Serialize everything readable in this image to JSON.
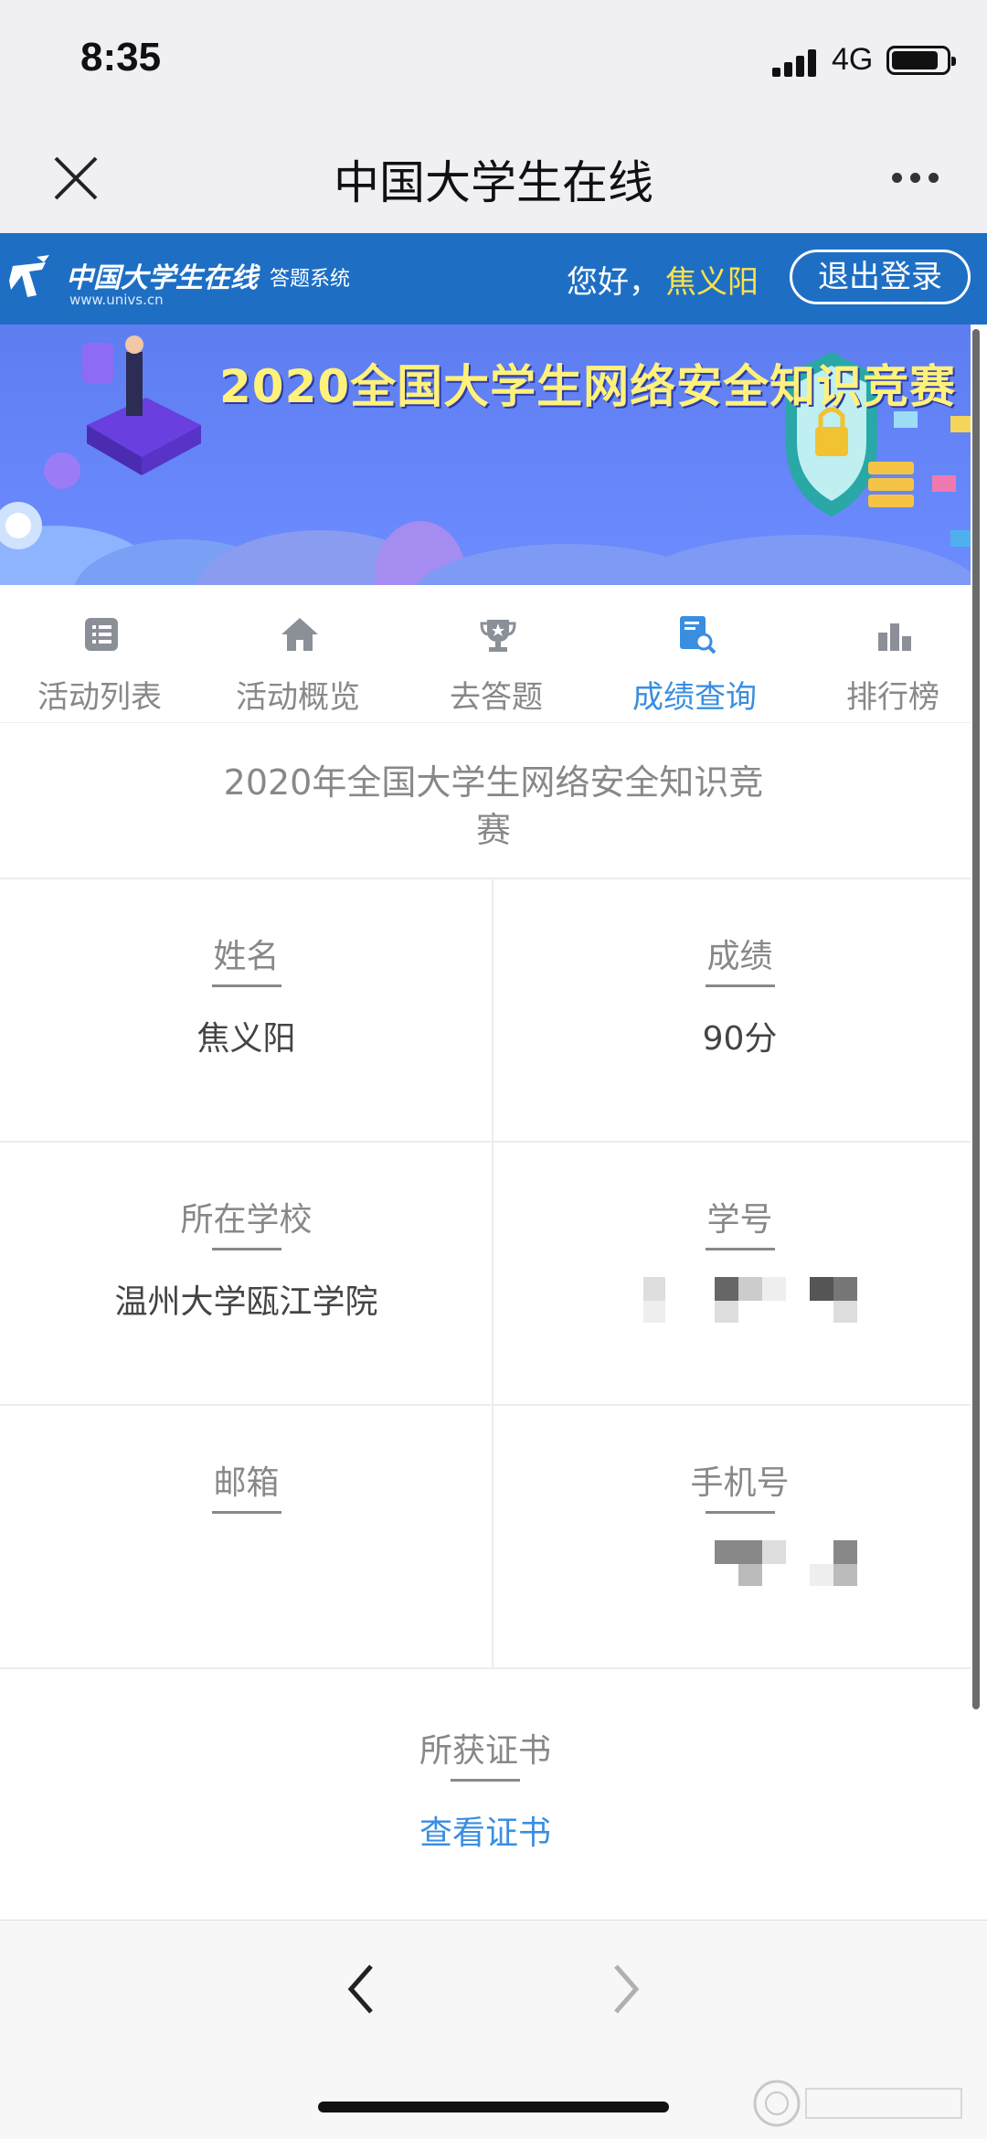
{
  "status_bar": {
    "time": "8:35",
    "network": "4G"
  },
  "nav": {
    "title": "中国大学生在线"
  },
  "web_header": {
    "logo_text": "中国大学生在线",
    "logo_sub": "答题系统",
    "logo_url": "www.univs.cn",
    "greeting": "您好，",
    "username": "焦义阳",
    "logout": "退出登录"
  },
  "banner": {
    "title": "2020全国大学生网络安全知识竞赛"
  },
  "tabs": [
    {
      "label": "活动列表",
      "icon": "list-icon"
    },
    {
      "label": "活动概览",
      "icon": "home-icon"
    },
    {
      "label": "去答题",
      "icon": "trophy-icon"
    },
    {
      "label": "成绩查询",
      "icon": "search-doc-icon",
      "active": true
    },
    {
      "label": "排行榜",
      "icon": "ranking-icon"
    }
  ],
  "competition": {
    "title_line1": "2020年全国大学生网络安全知识竞",
    "title_line2": "赛"
  },
  "fields": {
    "name": {
      "label": "姓名",
      "value": "焦义阳"
    },
    "score": {
      "label": "成绩",
      "value": "90分"
    },
    "school": {
      "label": "所在学校",
      "value": "温州大学瓯江学院"
    },
    "student_id": {
      "label": "学号",
      "value": ""
    },
    "email": {
      "label": "邮箱",
      "value": ""
    },
    "phone": {
      "label": "手机号",
      "value": ""
    }
  },
  "certificate": {
    "label": "所获证书",
    "link": "查看证书"
  },
  "colors": {
    "header_blue": "#1e6fc4",
    "active_blue": "#3a8ee0",
    "username_yellow": "#ffe14a"
  }
}
